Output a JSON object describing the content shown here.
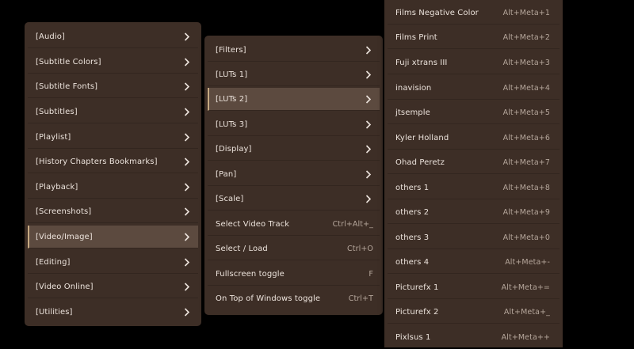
{
  "menu_main": {
    "items": [
      {
        "label": "[Audio]"
      },
      {
        "label": "[Subtitle Colors]"
      },
      {
        "label": "[Subtitle Fonts]"
      },
      {
        "label": "[Subtitles]"
      },
      {
        "label": "[Playlist]"
      },
      {
        "label": "[History Chapters Bookmarks]"
      },
      {
        "label": "[Playback]"
      },
      {
        "label": "[Screenshots]"
      },
      {
        "label": "[Video/Image]"
      },
      {
        "label": "[Editing]"
      },
      {
        "label": "[Video Online]"
      },
      {
        "label": "[Utilities]"
      }
    ],
    "active_item": "[Video/Image]"
  },
  "menu_video": {
    "items": [
      {
        "label": "[Filters]",
        "shortcut": ""
      },
      {
        "label": "[LUTs 1]",
        "shortcut": ""
      },
      {
        "label": "[LUTs 2]",
        "shortcut": ""
      },
      {
        "label": "[LUTs 3]",
        "shortcut": ""
      },
      {
        "label": "[Display]",
        "shortcut": ""
      },
      {
        "label": "[Pan]",
        "shortcut": ""
      },
      {
        "label": "[Scale]",
        "shortcut": ""
      },
      {
        "label": "Select Video Track",
        "shortcut": "Ctrl+Alt+_"
      },
      {
        "label": "Select / Load",
        "shortcut": "Ctrl+O"
      },
      {
        "label": "Fullscreen toggle",
        "shortcut": "F"
      },
      {
        "label": "On Top of Windows toggle",
        "shortcut": "Ctrl+T"
      }
    ],
    "active_item": "[LUTs 2]"
  },
  "menu_luts2": {
    "items": [
      {
        "label": "Films Negative Color",
        "shortcut": "Alt+Meta+1"
      },
      {
        "label": "Films Print",
        "shortcut": "Alt+Meta+2"
      },
      {
        "label": "Fuji xtrans III",
        "shortcut": "Alt+Meta+3"
      },
      {
        "label": "inavision",
        "shortcut": "Alt+Meta+4"
      },
      {
        "label": "jtsemple",
        "shortcut": "Alt+Meta+5"
      },
      {
        "label": "Kyler Holland",
        "shortcut": "Alt+Meta+6"
      },
      {
        "label": "Ohad Peretz",
        "shortcut": "Alt+Meta+7"
      },
      {
        "label": "others 1",
        "shortcut": "Alt+Meta+8"
      },
      {
        "label": "others 2",
        "shortcut": "Alt+Meta+9"
      },
      {
        "label": "others 3",
        "shortcut": "Alt+Meta+0"
      },
      {
        "label": "others 4",
        "shortcut": "Alt+Meta+-"
      },
      {
        "label": "Picturefx 1",
        "shortcut": "Alt+Meta+="
      },
      {
        "label": "Picturefx 2",
        "shortcut": "Alt+Meta+_"
      },
      {
        "label": "Pixlsus 1",
        "shortcut": "Alt+Meta++"
      }
    ]
  },
  "colors": {
    "menu_bg": "#3d2e26",
    "active_bg": "#5c4a3f",
    "active_accent": "#c6a982",
    "text": "#ece3dc",
    "shortcut_text": "#b5a69b"
  },
  "icons": {
    "submenu": "chevron-right-icon"
  }
}
